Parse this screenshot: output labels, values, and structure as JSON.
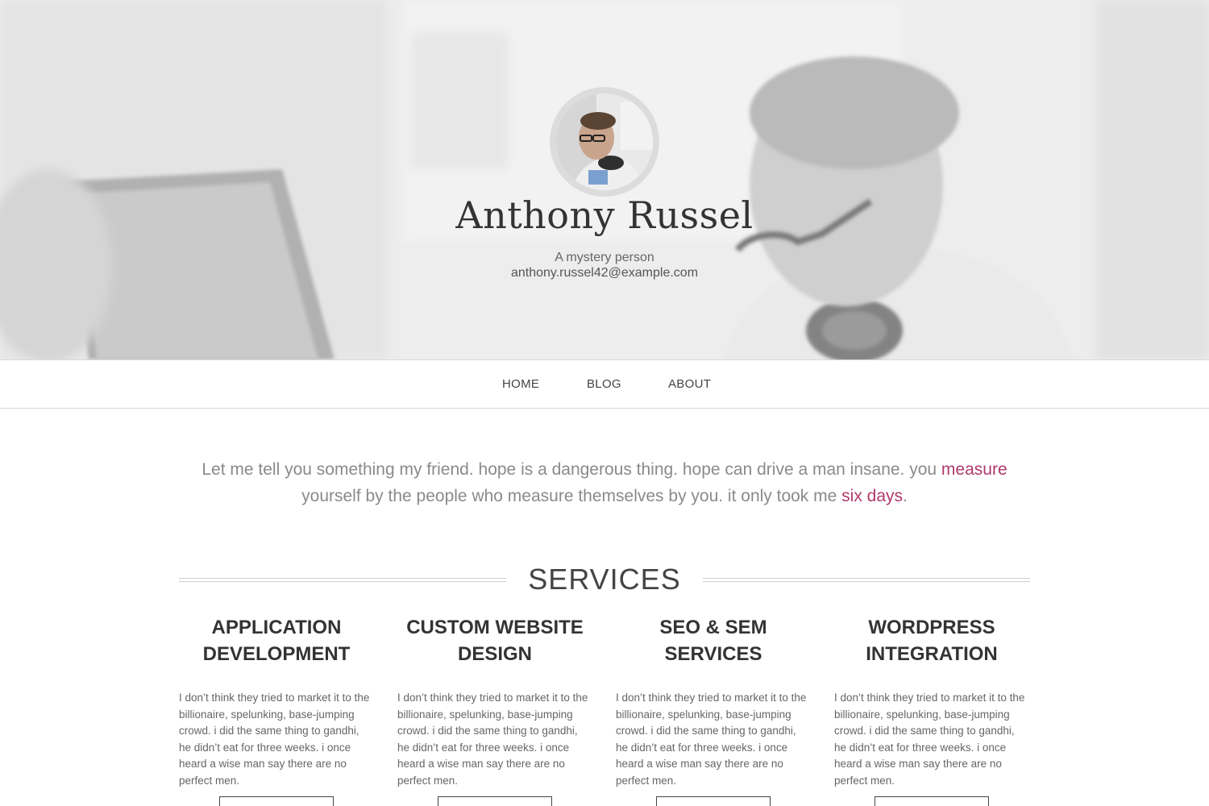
{
  "profile": {
    "name": "Anthony Russel",
    "tagline": "A mystery person",
    "email": "anthony.russel42@example.com"
  },
  "nav": {
    "items": [
      {
        "label": "HOME"
      },
      {
        "label": "BLOG"
      },
      {
        "label": "ABOUT"
      }
    ]
  },
  "intro": {
    "part1": "Let me tell you something my friend. hope is a dangerous thing. hope can drive a man insane. you ",
    "link1": "measure",
    "part2": " yourself by the people who measure themselves by you. it only took me ",
    "link2": "six days",
    "part3": "."
  },
  "services": {
    "heading": "SERVICES",
    "items": [
      {
        "title": "APPLICATION DEVELOPMENT",
        "text": "I don’t think they tried to market it to the billionaire, spelunking, base-jumping crowd. i did the same thing to gandhi, he didn’t eat for three weeks. i once heard a wise man say there are no perfect men."
      },
      {
        "title": "CUSTOM WEBSITE DESIGN",
        "text": "I don’t think they tried to market it to the billionaire, spelunking, base-jumping crowd. i did the same thing to gandhi, he didn’t eat for three weeks. i once heard a wise man say there are no perfect men."
      },
      {
        "title": "SEO & SEM SERVICES",
        "text": "I don’t think they tried to market it to the billionaire, spelunking, base-jumping crowd. i did the same thing to gandhi, he didn’t eat for three weeks. i once heard a wise man say there are no perfect men."
      },
      {
        "title": "WORDPRESS INTEGRATION",
        "text": "I don’t think they tried to market it to the billionaire, spelunking, base-jumping crowd. i did the same thing to gandhi, he didn’t eat for three weeks. i once heard a wise man say there are no perfect men."
      }
    ]
  },
  "colors": {
    "accent": "#b03a6a",
    "hero_bg": "#ececec",
    "text": "#333333",
    "muted": "#8a8a8a"
  }
}
